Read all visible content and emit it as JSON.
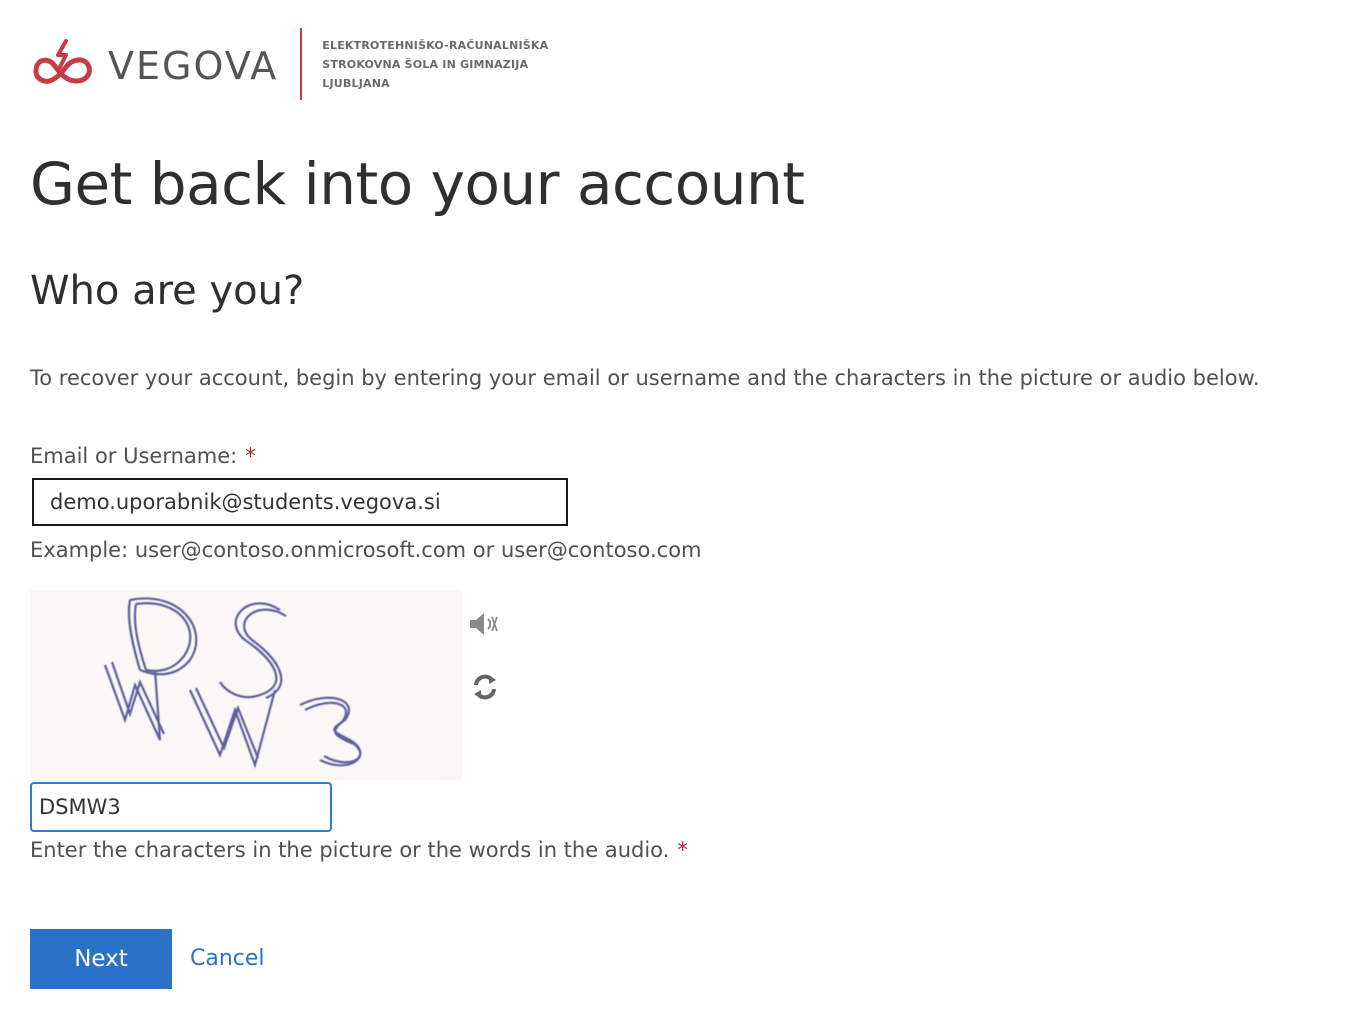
{
  "logo": {
    "word": "VEGOVA",
    "lines": [
      "ELEKTROTEHNIŠKO-RAČUNALNIŠKA",
      "STROKOVNA ŠOLA IN GIMNAZIJA",
      "LJUBLJANA"
    ],
    "brand_color": "#c83a46"
  },
  "page_title": "Get back into your account",
  "section_title": "Who are you?",
  "intro": "To recover your account, begin by entering your email or username and the characters in the picture or audio below.",
  "email": {
    "label": "Email or Username:",
    "required_mark": "*",
    "value": "demo.uporabnik@students.vegova.si",
    "example": "Example: user@contoso.onmicrosoft.com or user@contoso.com"
  },
  "captcha": {
    "audio_icon": "speaker-icon",
    "refresh_icon": "refresh-icon",
    "value": "DSMW3",
    "hint": "Enter the characters in the picture or the words in the audio.",
    "required_mark": "*"
  },
  "buttons": {
    "next": "Next",
    "cancel": "Cancel"
  },
  "colors": {
    "primary": "#2a72c7",
    "required": "#a4262c",
    "focus_border": "#2b7cd3"
  }
}
